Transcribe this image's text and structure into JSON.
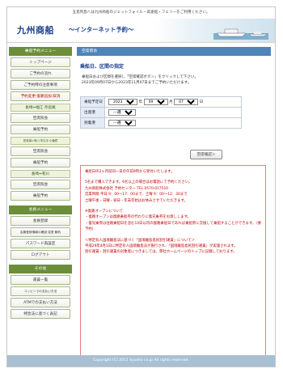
{
  "top_note": "五島列島へは九州商船のジェットフォイル・高速船・フェリーをご利用ください。",
  "header": {
    "logo": "九州商船",
    "subtitle": "〜インターネット予約〜"
  },
  "sidebar": {
    "menu_title": "乗船予約メニュー",
    "items_top": [
      {
        "label": "トップページ",
        "red": false
      },
      {
        "label": "ご予約の流れ",
        "red": false
      },
      {
        "label": "ご予約時の注意事項",
        "red": false
      },
      {
        "label": "予約変更·復路追加·取消",
        "red": true
      }
    ],
    "section1": "長崎⇔福江·奈良尾",
    "section1_items": [
      "空席照会",
      "乗船予約"
    ],
    "section2": "佐世保⇔有川·宇久平·小値賀",
    "section2_items": [
      "空席照会",
      "乗船予約"
    ],
    "section3": "長崎⇔有川",
    "section3_items": [
      "空席照会",
      "乗船予約"
    ],
    "member_title": "会員メニュー",
    "member_items": [
      "会員登録",
      "会員登録情報の確認·変更·解約",
      "パスワード再設定",
      "ログアウト"
    ],
    "other_title": "その他",
    "other_items": [
      "運賃一覧",
      "コンビニでの支払い方法",
      "ATMでの支払い方法",
      "特急法に基づく表記"
    ]
  },
  "main": {
    "section_head": "空席照会",
    "title": "乗船日、区間の指定",
    "instr1": "乗船日および区間を選択し「空席確認ボタン」をクリックして下さい。",
    "instr2": "2023年09月07日から2023年11月07日までご予約いただけます。",
    "form": {
      "date_label": "乗船予定日",
      "year": "2023",
      "year_unit": "年",
      "month": "09",
      "month_unit": "月",
      "day": "07",
      "day_unit": "日",
      "dep_label": "出発港",
      "dep_value": "---選択---",
      "arr_label": "到着港",
      "arr_value": "---選択---"
    },
    "confirm_button": "空席確認＞",
    "notice": [
      "乗船日の2ヶ月前同一日の午前9時から受付いたします。",
      "5名まで購入できます。6名以上の場合はお電話にて予約ください。\n九州商船株式会社 予約センター TEL 0570-017510\n営業時間 平日 9：00〜17：00まで、土曜 9：00〜12：30まで\n土曜午後・日曜・祝日・年末年始はお休みさせていただきます。",
      "※復路オープンについて\n・復路オープンは復路乗船券の代わりに復兄乗券をお渡しします。\n・復兄乗券は往路乗船日を含む14日以内の復路乗船日であれば乗船券に交換して乗船することができます。（要予約）",
      "＜特定有人国境離島法に基づく「国境離島島民割引運賃」について＞\n平成29年4月1日に特定有人国境離島法が施行され、「国境離島島民割引運賃」が実施されます。\n割引運賃・割引運賃の対象者につきましては、弊社ホームページのトップに記載しております。"
    ]
  },
  "footer": "Copyright (C) 2011 kyusho co.jp All rights reserved."
}
